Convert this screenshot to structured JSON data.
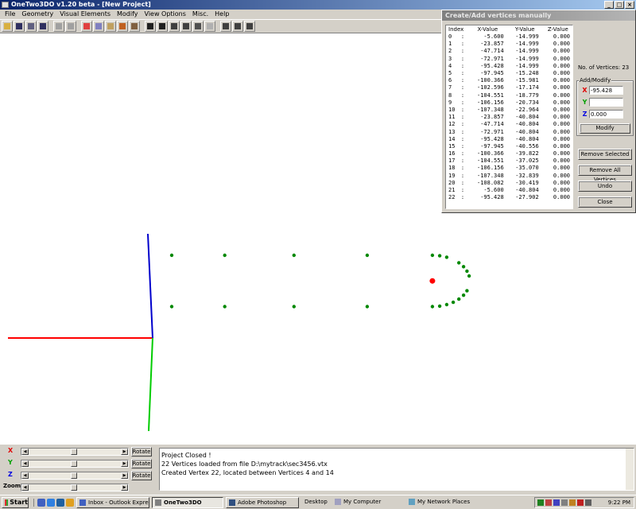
{
  "window": {
    "title": "OneTwo3DO  v1.20 beta - [New Project]",
    "min": "_",
    "max": "□",
    "close": "×"
  },
  "menu": [
    "File",
    "Geometry",
    "Visual Elements",
    "Modify",
    "View Options",
    "Misc.",
    "Help"
  ],
  "dialog": {
    "title": "Create/Add vertices manually",
    "columns": [
      "Index",
      "X-Value",
      "Y-Value",
      "Z-Value"
    ],
    "rows": [
      [
        "0",
        ":",
        "-5.600",
        "-14.999",
        "0.000"
      ],
      [
        "1",
        ":",
        "-23.857",
        "-14.999",
        "0.000"
      ],
      [
        "2",
        ":",
        "-47.714",
        "-14.999",
        "0.000"
      ],
      [
        "3",
        ":",
        "-72.971",
        "-14.999",
        "0.000"
      ],
      [
        "4",
        ":",
        "-95.428",
        "-14.999",
        "0.000"
      ],
      [
        "5",
        ":",
        "-97.945",
        "-15.248",
        "0.000"
      ],
      [
        "6",
        ":",
        "-100.366",
        "-15.981",
        "0.000"
      ],
      [
        "7",
        ":",
        "-102.596",
        "-17.174",
        "0.000"
      ],
      [
        "8",
        ":",
        "-104.551",
        "-18.779",
        "0.000"
      ],
      [
        "9",
        ":",
        "-106.156",
        "-20.734",
        "0.000"
      ],
      [
        "10",
        ":",
        "-107.348",
        "-22.964",
        "0.000"
      ],
      [
        "11",
        ":",
        "-23.857",
        "-40.804",
        "0.000"
      ],
      [
        "12",
        ":",
        "-47.714",
        "-40.804",
        "0.000"
      ],
      [
        "13",
        ":",
        "-72.971",
        "-40.804",
        "0.000"
      ],
      [
        "14",
        ":",
        "-95.428",
        "-40.804",
        "0.000"
      ],
      [
        "15",
        ":",
        "-97.945",
        "-40.556",
        "0.000"
      ],
      [
        "16",
        ":",
        "-100.366",
        "-39.822",
        "0.000"
      ],
      [
        "17",
        ":",
        "-104.551",
        "-37.025",
        "0.000"
      ],
      [
        "18",
        ":",
        "-106.156",
        "-35.070",
        "0.000"
      ],
      [
        "19",
        ":",
        "-107.348",
        "-32.839",
        "0.000"
      ],
      [
        "20",
        ":",
        "-108.082",
        "-30.419",
        "0.000"
      ],
      [
        "21",
        ":",
        "-5.600",
        "-40.804",
        "0.000"
      ],
      [
        "22",
        ":",
        "-95.428",
        "-27.902",
        "0.000"
      ]
    ],
    "vertex_count": "No. of Vertices: 23",
    "add_modify_label": "Add/Modify",
    "x_label": "X",
    "x_value": "-95.428",
    "y_label": "Y",
    "y_value": "",
    "z_label": "Z",
    "z_value": "0.000",
    "modify": "Modify",
    "remove_selected": "Remove Selected",
    "remove_all": "Remove All Vertices",
    "undo": "Undo",
    "close": "Close"
  },
  "sliders": [
    {
      "label": "X",
      "color": "#e00000",
      "rotate": "Rotate"
    },
    {
      "label": "Y",
      "color": "#00a000",
      "rotate": "Rotate"
    },
    {
      "label": "Z",
      "color": "#0000e0",
      "rotate": "Rotate"
    },
    {
      "label": "Zoom",
      "color": "#000000"
    }
  ],
  "log": [
    "Project Closed !",
    "22 Vertices loaded from file D:\\mytrack\\sec3456.vtx",
    "Created Vertex 22, located between Vertices 4 and 14"
  ],
  "taskbar": {
    "start": "Start",
    "tasks": [
      "Inbox - Outlook Express",
      "OneTwo3DO",
      "Adobe Photoshop",
      "Desktop",
      "My Computer",
      "My Network Places"
    ],
    "clock": "9:22 PM"
  },
  "colors": {
    "x_axis": "#ff0000",
    "y_axis": "#00cc00",
    "z_axis": "#0000cc",
    "vertex": "#008800",
    "selected_vertex": "#ff0000"
  }
}
